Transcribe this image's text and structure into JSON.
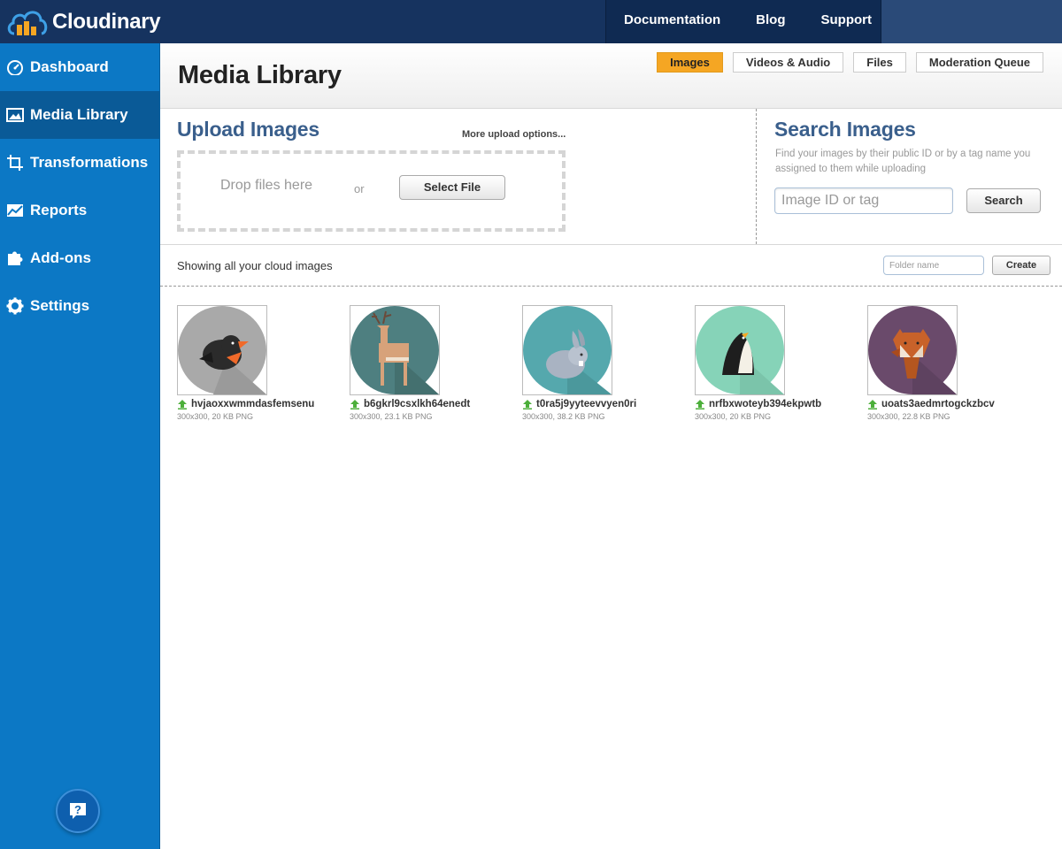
{
  "brand": {
    "name": "Cloudinary"
  },
  "topnav": {
    "documentation": "Documentation",
    "blog": "Blog",
    "support": "Support"
  },
  "sidebar": {
    "items": [
      {
        "label": "Dashboard",
        "icon": "dashboard-icon"
      },
      {
        "label": "Media Library",
        "icon": "image-icon",
        "active": true
      },
      {
        "label": "Transformations",
        "icon": "crop-icon"
      },
      {
        "label": "Reports",
        "icon": "chart-icon"
      },
      {
        "label": "Add-ons",
        "icon": "puzzle-icon"
      },
      {
        "label": "Settings",
        "icon": "gear-icon"
      }
    ],
    "help": "?"
  },
  "header": {
    "title": "Media Library",
    "tabs": [
      {
        "label": "Images",
        "active": true
      },
      {
        "label": "Videos & Audio"
      },
      {
        "label": "Files"
      },
      {
        "label": "Moderation Queue"
      }
    ]
  },
  "upload": {
    "title": "Upload Images",
    "more_options": "More upload options...",
    "drop_text": "Drop files here",
    "or": "or",
    "select_file": "Select File"
  },
  "search": {
    "title": "Search Images",
    "description": "Find your images by their public ID or by a tag name you assigned to them while uploading",
    "placeholder": "Image ID or tag",
    "button": "Search"
  },
  "listing": {
    "showing": "Showing all your cloud images",
    "folder_placeholder": "Folder name",
    "create": "Create"
  },
  "images": [
    {
      "name": "hvjaoxxwmmdasfemsenu",
      "meta": "300x300, 20 KB PNG",
      "bg": "#a9a9a9",
      "animal": "bird"
    },
    {
      "name": "b6gkrl9csxlkh64enedt",
      "meta": "300x300, 23.1 KB PNG",
      "bg": "#4e7f80",
      "animal": "deer"
    },
    {
      "name": "t0ra5j9yyteevvyen0ri",
      "meta": "300x300, 38.2 KB PNG",
      "bg": "#55a8ad",
      "animal": "rabbit"
    },
    {
      "name": "nrfbxwoteyb394ekpwtb",
      "meta": "300x300, 20 KB PNG",
      "bg": "#86d3b8",
      "animal": "penguin"
    },
    {
      "name": "uoats3aedmrtogckzbcv",
      "meta": "300x300, 22.8 KB PNG",
      "bg": "#6a4a6b",
      "animal": "fox"
    }
  ]
}
